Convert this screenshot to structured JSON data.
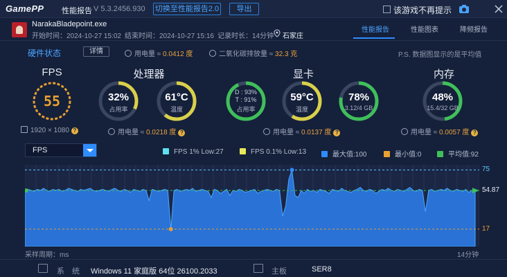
{
  "titlebar": {
    "logo": "GamePP",
    "title": "性能报告",
    "version": "V 5.3.2456.930",
    "switch_button": "切换至性能报告2.0",
    "export_button": "导出",
    "dont_show_label": "该游戏不再提示"
  },
  "session": {
    "exe": "NarakaBladepoint.exe",
    "start": "开始时间：2024-10-27 15:02",
    "end": "结束时间：2024-10-27 15:16",
    "duration": "记录时长：14分钟",
    "location": "石家庄"
  },
  "tabs": [
    {
      "label": "性能报告",
      "active": true
    },
    {
      "label": "性能图表",
      "active": false
    },
    {
      "label": "降频报告",
      "active": false
    }
  ],
  "status": {
    "hw_status": "硬件状态",
    "detail_button": "详情",
    "power_label": "用电量 ≈ ",
    "power_value": "0.0412 度",
    "co2_label": "二氧化碳排放量 ≈ ",
    "co2_value": "32.3 克",
    "ps_note": "P.S. 数据图显示的是平均值"
  },
  "sections": {
    "fps": {
      "title": "FPS",
      "value": "55",
      "resolution": "1920 × 1080"
    },
    "cpu": {
      "title": "处理器",
      "usage_value": "32%",
      "usage_label": "占用率",
      "usage_fraction": 0.32,
      "temp_value": "61°C",
      "temp_label": "温度",
      "temp_fraction": 0.61,
      "power_label": "用电量 ≈ ",
      "power_value": "0.0218 度"
    },
    "gpu": {
      "title": "显卡",
      "d_line": "D : 93%",
      "t_line": "T : 91%",
      "usage_label": "占用率",
      "usage_fraction": 0.93,
      "temp_value": "59°C",
      "temp_label": "温度",
      "temp_fraction": 0.59,
      "vram_value": "78%",
      "vram_label": "3.12/4 GB",
      "vram_fraction": 0.78,
      "power_label": "用电量 ≈ ",
      "power_value": "0.0137 度"
    },
    "mem": {
      "title": "内存",
      "usage_value": "48%",
      "usage_label": "15.4/32 GB",
      "usage_fraction": 0.48,
      "power_label": "用电量 ≈ ",
      "power_value": "0.0057 度"
    }
  },
  "chart_controls": {
    "metric_select": "FPS",
    "legend": [
      {
        "label": "FPS 1% Low:27",
        "color": "#5fe0f0"
      },
      {
        "label": "FPS 0.1% Low:13",
        "color": "#e8e85a"
      },
      {
        "label": "最大值:100",
        "color": "#2f8cff"
      },
      {
        "label": "最小值:0",
        "color": "#e8a030"
      },
      {
        "label": "平均值:92",
        "color": "#3fbf5a"
      }
    ]
  },
  "chart_data": {
    "type": "area",
    "series": [
      {
        "name": "FPS",
        "values": [
          55,
          56,
          55,
          54,
          56,
          55,
          57,
          55,
          54,
          56,
          55,
          56,
          54,
          55,
          57,
          56,
          55,
          54,
          56,
          55,
          56,
          57,
          55,
          54,
          55,
          56,
          55,
          54,
          56,
          57,
          55,
          54,
          56,
          55,
          53,
          56,
          55,
          54,
          56,
          55,
          45,
          56,
          55,
          54,
          55,
          56,
          55,
          17,
          55,
          56,
          54,
          55,
          56,
          55,
          57,
          54,
          55,
          56,
          55,
          54,
          48,
          56,
          55,
          52,
          54,
          56,
          50,
          55,
          54,
          56,
          55,
          53,
          54,
          55,
          56,
          52,
          54,
          55,
          56,
          55,
          54,
          56,
          55,
          30,
          40,
          66,
          75,
          50,
          48,
          55,
          52,
          56,
          54,
          55,
          53,
          56,
          55,
          54,
          52,
          56,
          55,
          54,
          57,
          55,
          54,
          53,
          55,
          56,
          58,
          55,
          54,
          56,
          55,
          52,
          54,
          56,
          55,
          57,
          55,
          54,
          56,
          55,
          54,
          56,
          58,
          55,
          54,
          56,
          55,
          34,
          55,
          56,
          54,
          55,
          56,
          55,
          57,
          55,
          54,
          56,
          55,
          54,
          56,
          53,
          55,
          56
        ]
      }
    ],
    "reference_lines": [
      {
        "label": "75",
        "value": 75
      },
      {
        "label": "54.87",
        "value": 54.87
      },
      {
        "label": "17",
        "value": 17
      }
    ],
    "x_start_label": "采样周期：ms",
    "x_end_label": "14分钟",
    "ylim": [
      0,
      80
    ]
  },
  "bottom": {
    "system_label": "系　统",
    "system_value": "Windows 11 家庭版 64位 26100.2033",
    "board_label": "主板",
    "board_value": "SER8"
  }
}
